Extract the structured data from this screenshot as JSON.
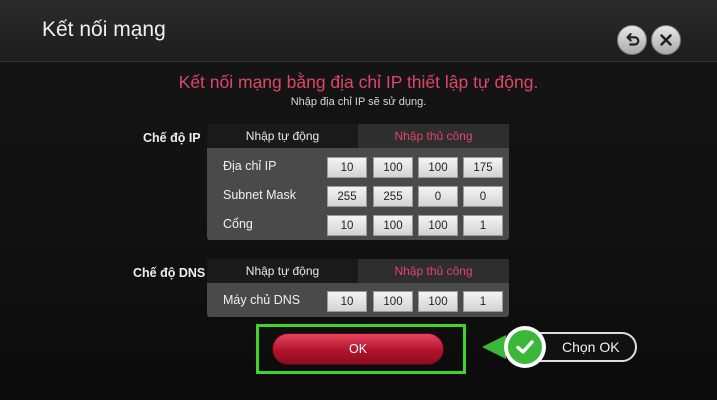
{
  "window": {
    "title": "Kết nối mạng"
  },
  "icons": {
    "back": "back-arrow-icon",
    "close": "close-icon",
    "check": "checkmark-icon"
  },
  "messages": {
    "headline": "Kết nối mạng bằng địa chỉ IP thiết lập tự động.",
    "subline": "Nhập địa chỉ IP sẽ sử dụng."
  },
  "ip_section": {
    "label": "Chế độ IP",
    "tabs": [
      {
        "label": "Nhập tự động",
        "selected": true
      },
      {
        "label": "Nhập thủ công",
        "selected": false
      }
    ],
    "rows": [
      {
        "label": "Địa chỉ IP",
        "values": [
          "10",
          "100",
          "100",
          "175"
        ]
      },
      {
        "label": "Subnet Mask",
        "values": [
          "255",
          "255",
          "0",
          "0"
        ]
      },
      {
        "label": "Cổng",
        "values": [
          "10",
          "100",
          "100",
          "1"
        ]
      }
    ]
  },
  "dns_section": {
    "label": "Chế độ DNS",
    "tabs": [
      {
        "label": "Nhập tự động",
        "selected": true
      },
      {
        "label": "Nhập thủ công",
        "selected": false
      }
    ],
    "rows": [
      {
        "label": "Máy chủ DNS",
        "values": [
          "10",
          "100",
          "100",
          "1"
        ]
      }
    ]
  },
  "actions": {
    "ok_label": "OK",
    "callout_label": "Chọn OK"
  },
  "colors": {
    "accent_pink": "#e0456b",
    "ok_red": "#b0142c",
    "highlight_green": "#3fd42a",
    "check_green": "#3bb83a"
  }
}
